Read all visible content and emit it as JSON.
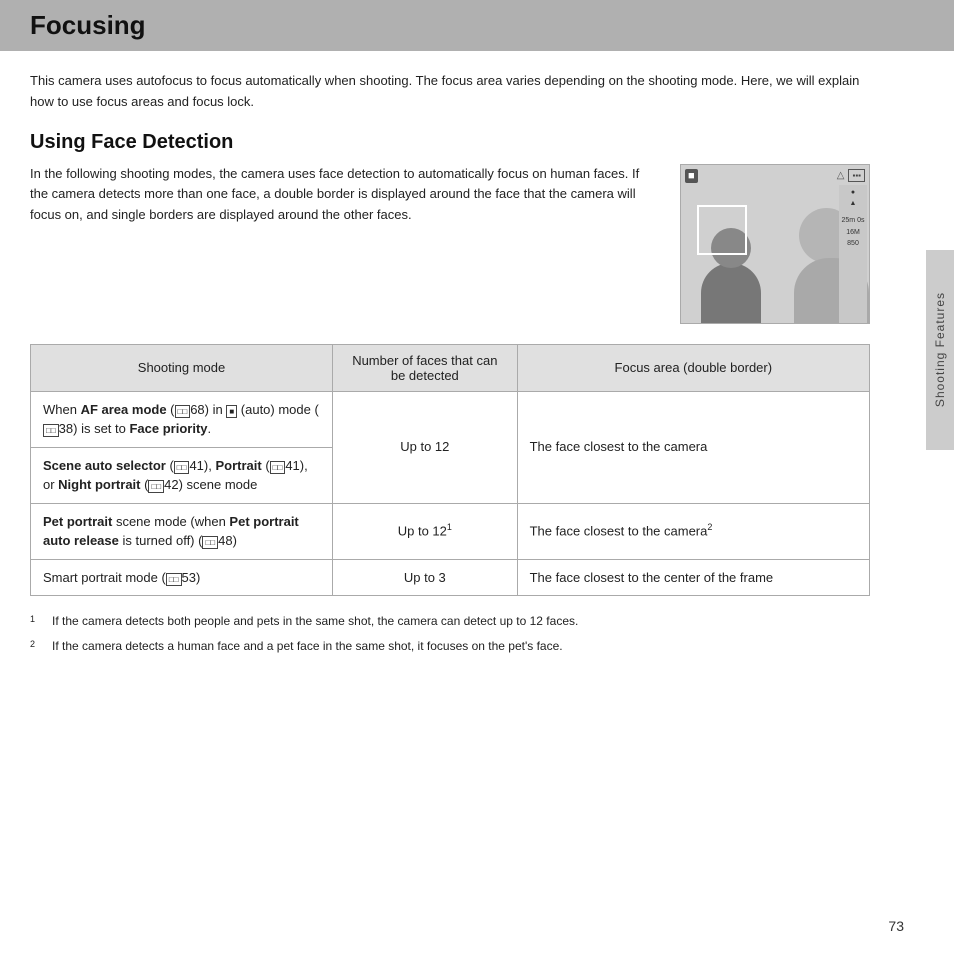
{
  "header": {
    "title": "Focusing",
    "bg_color": "#b0b0b0"
  },
  "intro": {
    "text": "This camera uses autofocus to focus automatically when shooting. The focus area varies depending on the shooting mode. Here, we will explain how to use focus areas and focus lock."
  },
  "section": {
    "title": "Using Face Detection",
    "description": "In the following shooting modes, the camera uses face detection to automatically focus on human faces. If the camera detects more than one face, a double border is displayed around the face that the camera will focus on, and single borders are displayed around the other faces."
  },
  "table": {
    "headers": [
      "Shooting mode",
      "Number of faces that can be detected",
      "Focus area (double border)"
    ],
    "rows": [
      {
        "shooting": "When AF area mode (□□68) in □ (auto) mode (□□38) is set to Face priority.",
        "faces": "Up to 12",
        "focus": "The face closest to the camera",
        "rowspan_faces": 2,
        "rowspan_focus": 2
      },
      {
        "shooting": "Scene auto selector (□□41), Portrait (□□41), or Night portrait (□□42) scene mode",
        "faces": null,
        "focus": null
      },
      {
        "shooting": "Pet portrait scene mode (when Pet portrait auto release is turned off) (□□48)",
        "faces": "Up to 121",
        "focus": "The face closest to the camera2"
      },
      {
        "shooting": "Smart portrait mode (□□53)",
        "faces": "Up to 3",
        "focus": "The face closest to the center of the frame"
      }
    ]
  },
  "footnotes": [
    {
      "num": "1",
      "text": "If the camera detects both people and pets in the same shot, the camera can detect up to 12 faces."
    },
    {
      "num": "2",
      "text": "If the camera detects a human face and a pet face in the same shot, it focuses on the pet's face."
    }
  ],
  "sidebar_label": "Shooting Features",
  "page_number": "73"
}
